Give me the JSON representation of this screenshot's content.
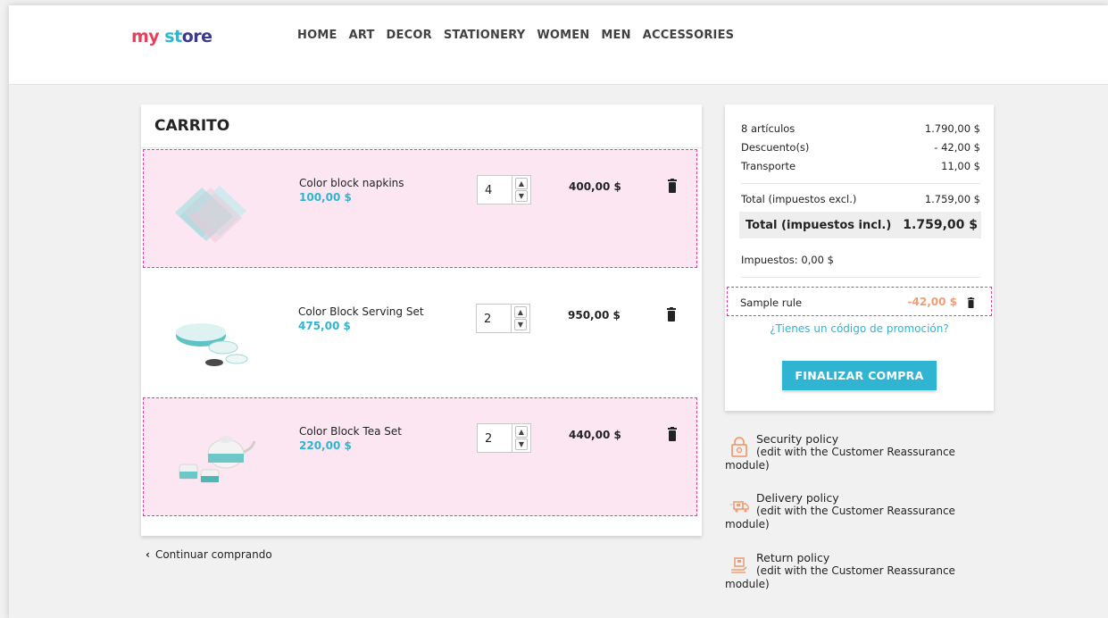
{
  "store": {
    "logo_parts": [
      "my",
      " st",
      "ore"
    ]
  },
  "nav": {
    "items": [
      "HOME",
      "ART",
      "DECOR",
      "STATIONERY",
      "WOMEN",
      "MEN",
      "ACCESSORIES"
    ]
  },
  "cart": {
    "title": "CARRITO",
    "lines": [
      {
        "name": "Color block napkins",
        "unit_price": "100,00 $",
        "quantity": "4",
        "total": "400,00 $",
        "highlighted": true
      },
      {
        "name": "Color Block Serving Set",
        "unit_price": "475,00 $",
        "quantity": "2",
        "total": "950,00 $",
        "highlighted": false
      },
      {
        "name": "Color Block Tea Set",
        "unit_price": "220,00 $",
        "quantity": "2",
        "total": "440,00 $",
        "highlighted": true
      }
    ],
    "continue_label": "Continuar comprando"
  },
  "summary": {
    "items_label": "8 artículos",
    "items_value": "1.790,00 $",
    "discount_label": "Descuento(s)",
    "discount_value": "- 42,00 $",
    "shipping_label": "Transporte",
    "shipping_value": "11,00 $",
    "total_excl_label": "Total (impuestos excl.)",
    "total_excl_value": "1.759,00 $",
    "total_incl_label": "Total (impuestos incl.)",
    "total_incl_value": "1.759,00 $",
    "taxes_label": "Impuestos: 0,00 $",
    "rule_label": "Sample rule",
    "rule_value": "-42,00 $",
    "promo_link": "¿Tienes un código de promoción?",
    "checkout_label": "FINALIZAR COMPRA"
  },
  "reassurance": [
    {
      "title": "Security policy",
      "line2": "(edit with the Customer Reassurance",
      "line3": "module)",
      "icon": "shield-lock-icon"
    },
    {
      "title": "Delivery policy",
      "line2": "(edit with the Customer Reassurance",
      "line3": "module)",
      "icon": "truck-icon"
    },
    {
      "title": "Return policy",
      "line2": "(edit with the Customer Reassurance",
      "line3": "module)",
      "icon": "return-box-icon"
    }
  ],
  "colors": {
    "accent": "#2fb5d2",
    "highlight_bg": "#fbe6f2",
    "highlight_border": "#e63c9a",
    "discount": "#f39d72",
    "reassurance_icon": "#f19d76"
  }
}
